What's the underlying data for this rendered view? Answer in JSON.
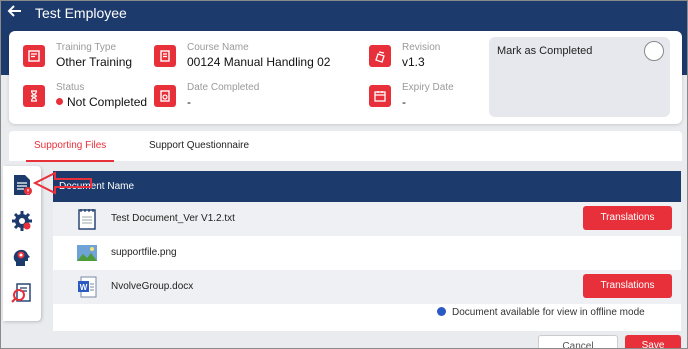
{
  "header": {
    "title": "Test Employee",
    "back_icon": "arrow-left-icon"
  },
  "details": {
    "training_type": {
      "label": "Training Type",
      "value": "Other Training"
    },
    "course_name": {
      "label": "Course Name",
      "value": "00124 Manual Handling 02"
    },
    "revision": {
      "label": "Revision",
      "value": "v1.3"
    },
    "status": {
      "label": "Status",
      "value": "Not Completed"
    },
    "date_completed": {
      "label": "Date Completed",
      "value": "-"
    },
    "expiry_date": {
      "label": "Expiry Date",
      "value": "-"
    },
    "mark_completed": {
      "label": "Mark as Completed",
      "checked": false
    }
  },
  "tabs": [
    {
      "label": "Supporting Files",
      "active": true
    },
    {
      "label": "Support Questionnaire",
      "active": false
    }
  ],
  "table": {
    "header": "Document Name",
    "rows": [
      {
        "name": "Test Document_Ver V1.2.txt",
        "icon": "notepad-icon",
        "button": "Translations"
      },
      {
        "name": "supportfile.png",
        "icon": "image-file-icon",
        "button": ""
      },
      {
        "name": "NvolveGroup.docx",
        "icon": "word-file-icon",
        "button": "Translations"
      }
    ]
  },
  "offline_note": "Document available for view in offline mode",
  "footer": {
    "cancel": "Cancel",
    "save": "Save"
  },
  "sidebar": [
    "document-icon",
    "gear-icon",
    "head-gear-icon",
    "search-document-icon"
  ],
  "colors": {
    "primary": "#1c3a6b",
    "accent": "#e8303a",
    "background": "#e9ebef"
  }
}
